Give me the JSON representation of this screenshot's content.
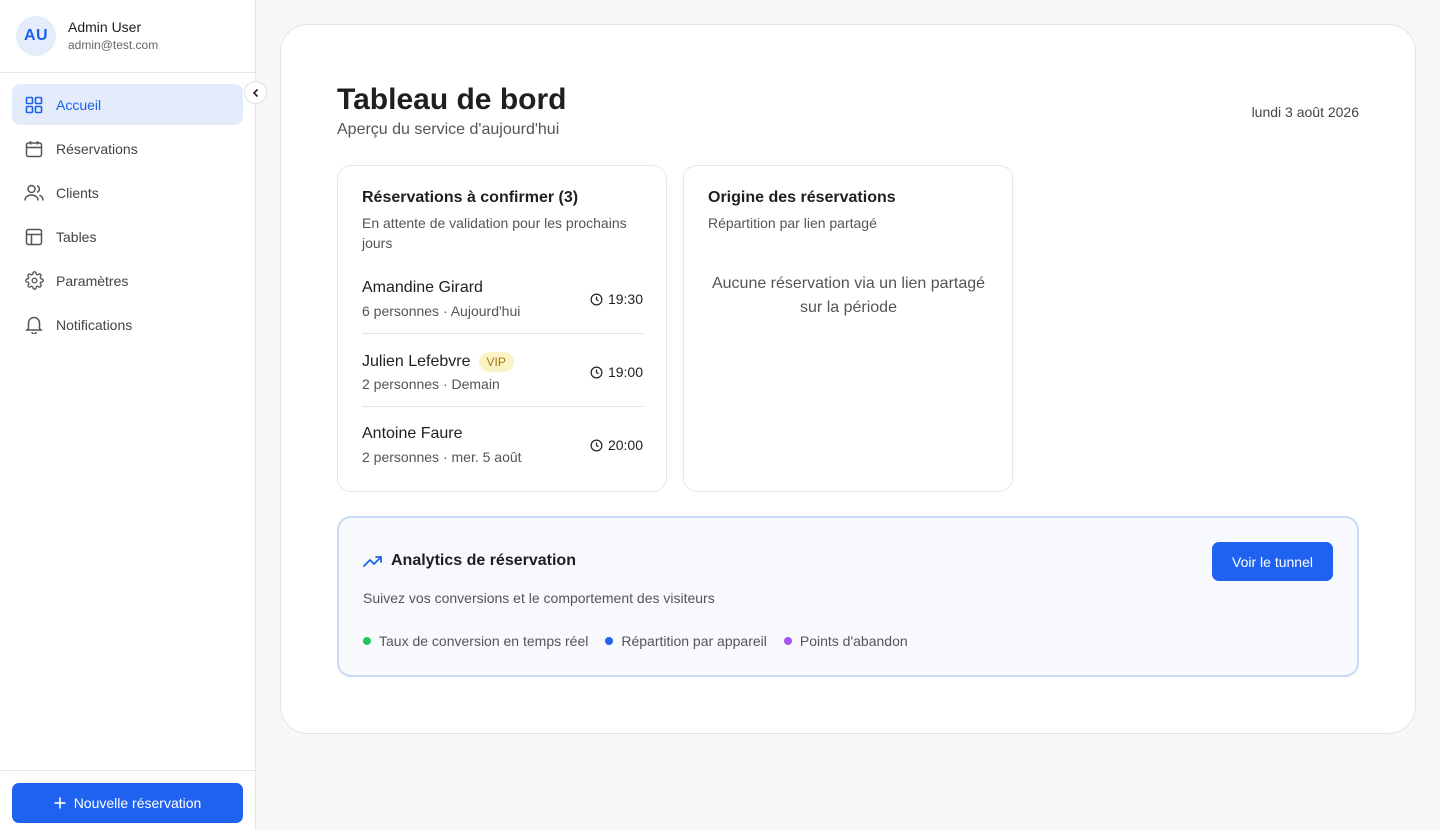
{
  "user": {
    "initials": "AU",
    "name": "Admin User",
    "email": "admin@test.com"
  },
  "sidebar": {
    "items": [
      {
        "label": "Accueil",
        "icon": "grid-icon",
        "active": true
      },
      {
        "label": "Réservations",
        "icon": "calendar-icon"
      },
      {
        "label": "Clients",
        "icon": "users-icon"
      },
      {
        "label": "Tables",
        "icon": "table-icon"
      },
      {
        "label": "Paramètres",
        "icon": "gear-icon"
      },
      {
        "label": "Notifications",
        "icon": "bell-icon"
      }
    ],
    "new_button": "Nouvelle réservation"
  },
  "header": {
    "title": "Tableau de bord",
    "subtitle": "Aperçu du service d'aujourd'hui",
    "date": "lundi 3 août 2026"
  },
  "pending": {
    "title": "Réservations à confirmer (3)",
    "description": "En attente de validation pour les prochains jours",
    "items": [
      {
        "name": "Amandine Girard",
        "meta": "6 personnes · Aujourd'hui",
        "time": "19:30"
      },
      {
        "name": "Julien Lefebvre",
        "badge": "VIP",
        "meta": "2 personnes · Demain",
        "time": "19:00"
      },
      {
        "name": "Antoine Faure",
        "meta": "2 personnes · mer. 5 août",
        "time": "20:00"
      }
    ]
  },
  "origin": {
    "title": "Origine des réservations",
    "description": "Répartition par lien partagé",
    "empty": "Aucune réservation via un lien partagé sur la période"
  },
  "analytics": {
    "title": "Analytics de réservation",
    "description": "Suivez vos conversions et le comportement des visiteurs",
    "button": "Voir le tunnel",
    "tags": [
      {
        "label": "Taux de conversion en temps réel",
        "color": "#22c55e"
      },
      {
        "label": "Répartition par appareil",
        "color": "#2563eb"
      },
      {
        "label": "Points d'abandon",
        "color": "#a855f7"
      }
    ]
  },
  "colors": {
    "accent": "#1f62f0",
    "active_bg": "#e4ecfb"
  }
}
